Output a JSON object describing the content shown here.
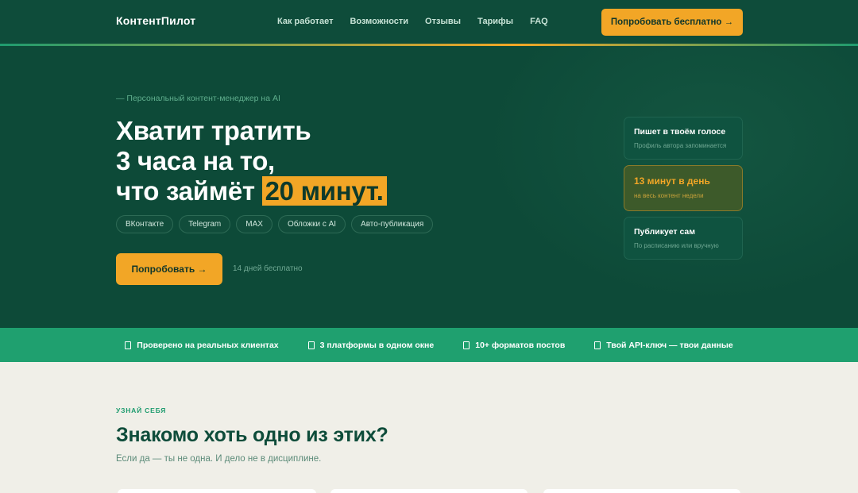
{
  "header": {
    "logo": "КонтентПилот",
    "nav": [
      "Как работает",
      "Возможности",
      "Отзывы",
      "Тарифы",
      "FAQ"
    ],
    "cta": "Попробовать бесплатно →"
  },
  "hero": {
    "eyebrow": "— Персональный контент-менеджер на AI",
    "title_line1": "Хватит тратить",
    "title_line2": "3 часа на то,",
    "title_line3_pre": "что займёт ",
    "title_highlight": "20 минут.",
    "chips": [
      "ВКонтакте",
      "Telegram",
      "MAX",
      "Обложки с AI",
      "Авто-публикация"
    ],
    "cta": "Попробовать →",
    "trial_note": "14 дней бесплатно",
    "cards": [
      {
        "title": "Пишет в твоём голосе",
        "subtitle": "Профиль автора запоминается"
      },
      {
        "title": "13 минут в день",
        "subtitle": "на весь контент недели"
      },
      {
        "title": "Публикует сам",
        "subtitle": "По расписанию или вручную"
      }
    ]
  },
  "benefits": [
    "Проверено на реальных клиентах",
    "3 платформы в одном окне",
    "10+ форматов постов",
    "Твой API-ключ — твои данные"
  ],
  "section": {
    "label": "УЗНАЙ СЕБЯ",
    "title": "Знакомо хоть одно из этих?",
    "subtitle": "Если да — ты не одна. И дело не в дисциплине."
  },
  "colors": {
    "header_bg": "#0e4c3a",
    "hero_bg": "#0d4a38",
    "accent": "#f2a626",
    "bar_bg": "#1fa06f",
    "section_bg": "#f0efe8"
  }
}
